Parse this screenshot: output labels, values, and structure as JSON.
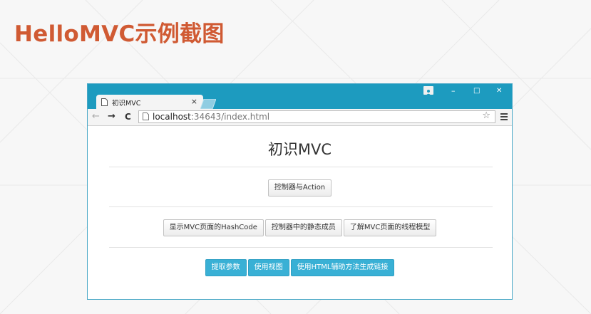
{
  "slide": {
    "title": "HelloMVC示例截图"
  },
  "browser": {
    "tab": {
      "title": "初识MVC",
      "close_glyph": "×",
      "icon": "page-icon"
    },
    "window_controls": {
      "user_icon": "user-icon",
      "minimize": "–",
      "maximize": "□",
      "close": "✕"
    },
    "toolbar": {
      "back_glyph": "←",
      "forward_glyph": "→",
      "reload_glyph": "C",
      "url_host": "localhost",
      "url_rest": ":34643/index.html",
      "bookmark_glyph": "☆",
      "menu_icon": "menu-icon"
    },
    "colors": {
      "frame": "#1d9bbf",
      "accent_button": "#39b0d5",
      "slide_title": "#d05a33"
    }
  },
  "page": {
    "heading": "初识MVC",
    "row1": [
      "控制器与Action"
    ],
    "row2": [
      "显示MVC页面的HashCode",
      "控制器中的静态成员",
      "了解MVC页面的线程模型"
    ],
    "row3": [
      "提取参数",
      "使用视图",
      "使用HTML辅助方法生成链接"
    ]
  }
}
